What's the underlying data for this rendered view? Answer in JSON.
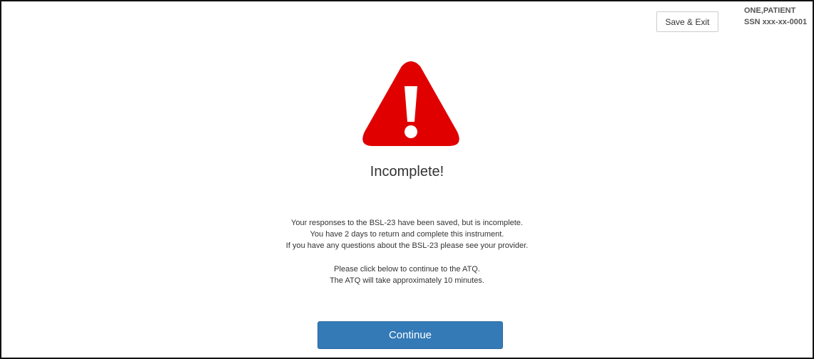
{
  "header": {
    "save_exit_label": "Save & Exit",
    "patient_name": "ONE,PATIENT",
    "patient_ssn": "SSN xxx-xx-0001"
  },
  "alert": {
    "icon": "warning-triangle-icon",
    "icon_color": "#e00000",
    "title": "Incomplete!",
    "status_lines": [
      "Your responses to the BSL-23 have been saved, but is incomplete.",
      "You have 2 days to return and complete this instrument.",
      "If you have any questions about the BSL-23 please see your provider."
    ],
    "next_lines": [
      "Please click below to continue to the ATQ.",
      "The ATQ will take approximately 10 minutes."
    ]
  },
  "actions": {
    "continue_label": "Continue",
    "continue_color": "#337ab7"
  }
}
